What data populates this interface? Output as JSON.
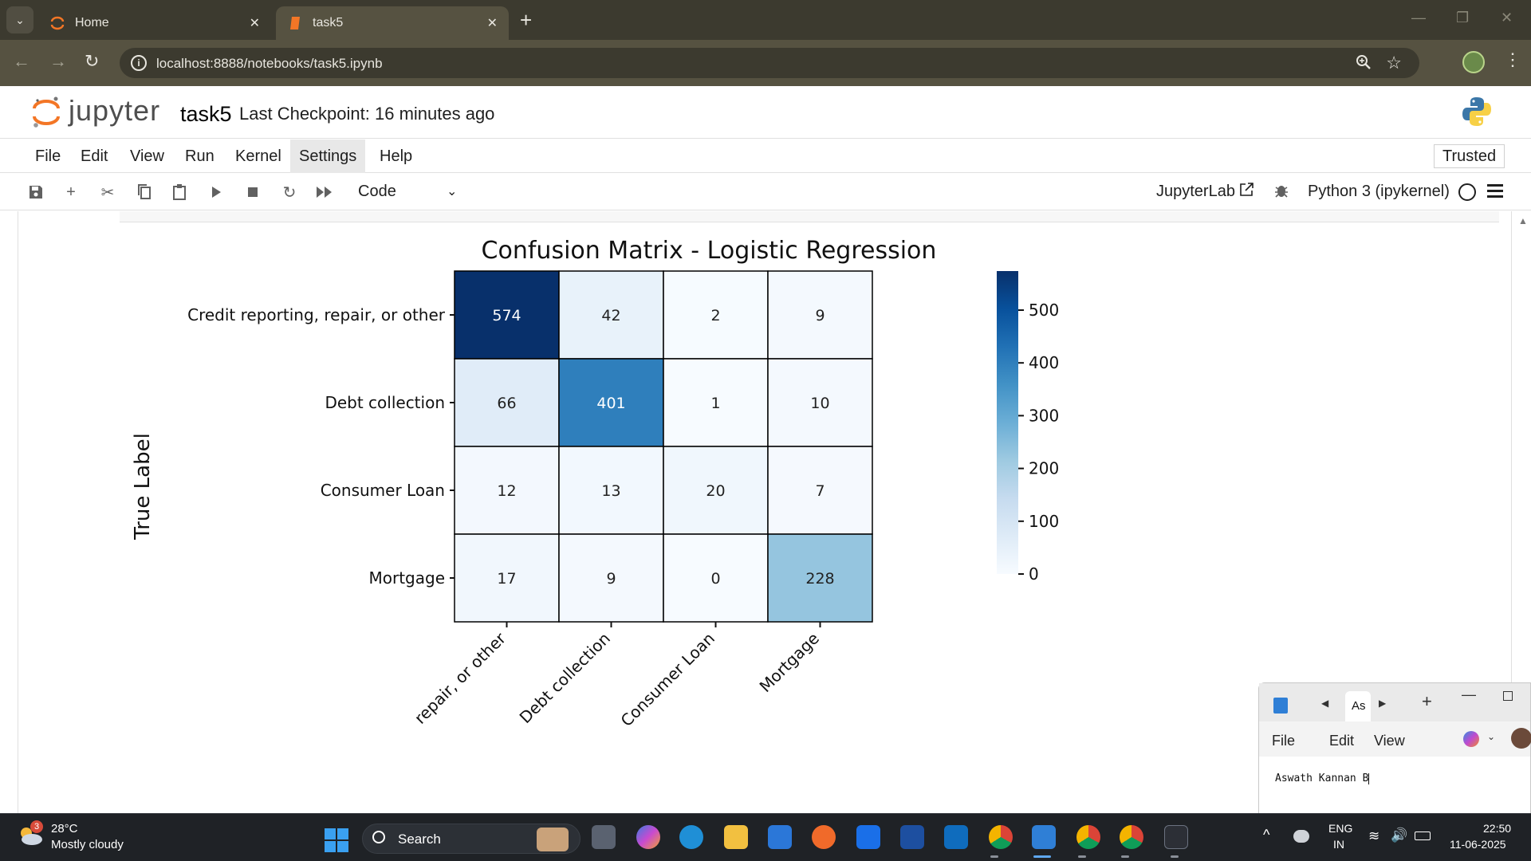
{
  "browser": {
    "tabs": [
      {
        "label": "Home",
        "active": false
      },
      {
        "label": "task5",
        "active": true
      }
    ],
    "url": "localhost:8888/notebooks/task5.ipynb"
  },
  "jupyter": {
    "brand": "jupyter",
    "notebook_title": "task5",
    "checkpoint": "Last Checkpoint: 16 minutes ago",
    "menu": [
      "File",
      "Edit",
      "View",
      "Run",
      "Kernel",
      "Settings",
      "Help"
    ],
    "trusted": "Trusted",
    "cell_type": "Code",
    "jupyterlab_link": "JupyterLab",
    "kernel_name": "Python 3 (ipykernel)",
    "accent": "#f37626"
  },
  "chart_data": {
    "type": "heatmap",
    "title": "Confusion Matrix - Logistic Regression",
    "ylabel": "True Label",
    "row_labels": [
      "Credit reporting, repair, or other",
      "Debt collection",
      "Consumer Loan",
      "Mortgage"
    ],
    "col_labels": [
      "repair, or other",
      "Debt collection",
      "Consumer Loan",
      "Mortgage"
    ],
    "values": [
      [
        574,
        42,
        2,
        9
      ],
      [
        66,
        401,
        1,
        10
      ],
      [
        12,
        13,
        20,
        7
      ],
      [
        17,
        9,
        0,
        228
      ]
    ],
    "colorbar": {
      "min": 0,
      "max": 574,
      "ticks": [
        "0",
        "100",
        "200",
        "300",
        "400",
        "500"
      ],
      "cmap": "Blues"
    }
  },
  "notepad": {
    "tab_label": "As",
    "menu": [
      "File",
      "Edit",
      "View"
    ],
    "text": "Aswath Kannan B"
  },
  "taskbar": {
    "weather_badge": "3",
    "temperature": "28°C",
    "weather": "Mostly cloudy",
    "search_label": "Search",
    "lang_line1": "ENG",
    "lang_line2": "IN",
    "time": "22:50",
    "date": "11-06-2025"
  }
}
